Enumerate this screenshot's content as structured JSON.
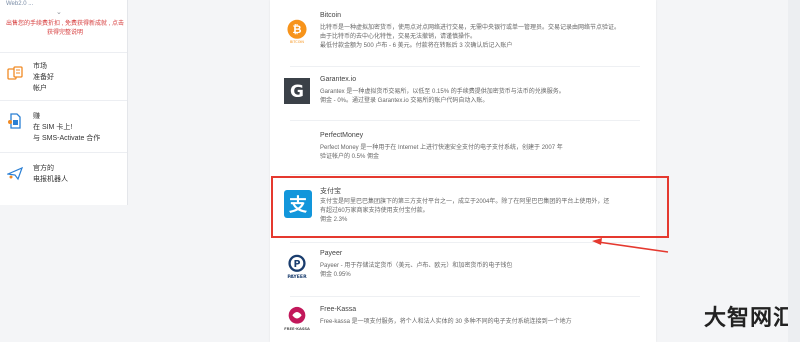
{
  "sidebar": {
    "top_label": "Web2.0 ...",
    "notice": "出售您的手续费折扣 , 免费获得新成就 , 点击获得完整说明",
    "items": [
      {
        "icon": "market-icon",
        "lines": [
          "市场",
          "准备好",
          "帐户"
        ]
      },
      {
        "icon": "sim-card-icon",
        "lines": [
          "赚",
          "在 SIM 卡上!",
          "与 SMS-Activate 合作"
        ]
      },
      {
        "icon": "robot-icon",
        "lines": [
          "官方的",
          "电报机器人"
        ]
      }
    ]
  },
  "payments": [
    {
      "name": "Bitcoin",
      "desc": [
        "比特币是一种虚拟加密货币，使用点对点网络进行交易，无需中央银行或单一管理员。交易记录由网络节点验证。",
        "由于比特币的去中心化特性，交易无法撤销，请谨慎操作。"
      ],
      "fee": "最低付款金额为 500 卢布 - 6 美元。付款将在转账后 3 次确认后记入账户"
    },
    {
      "name": "Garantex.io",
      "desc": [
        "Garantex 是一种虚拟货币交易所，以低至 0.15% 的手续费提供加密货币与法币的兑换服务。"
      ],
      "fee": "佣金 - 0%。通过登录 Garantex.io 交易所的账户代码自动入账。"
    },
    {
      "name": "PerfectMoney",
      "desc": [
        "Perfect Money 是一种用于在 Internet 上进行快速安全支付的电子支付系统，创建于 2007 年"
      ],
      "fee": "验证帐户的 0.5% 佣金"
    },
    {
      "name": "支付宝",
      "desc": [
        "支付宝是阿里巴巴集团旗下的第三方支付平台之一，成立于2004年。除了在阿里巴巴集团的平台上使用外，还",
        "有超过60万家商家支持使用支付宝付款。"
      ],
      "fee": "佣金 2.3%"
    },
    {
      "name": "Payeer",
      "desc": [
        "Payeer - 用于存储法定货币（美元、卢布、欧元）和加密货币的电子钱包"
      ],
      "fee": "佣金 0.95%"
    },
    {
      "name": "Free-Kassa",
      "desc": [
        "Free-kassa 是一项支付服务，将个人和法人实体的 30 多种不同的电子支付系统连接到一个地方"
      ],
      "fee": ""
    }
  ],
  "watermark": "大智网汇",
  "colors": {
    "highlight": "#e5392f",
    "bitcoin": "#f7931a",
    "alipay": "#1296db",
    "payeer": "#1a3d6e"
  }
}
